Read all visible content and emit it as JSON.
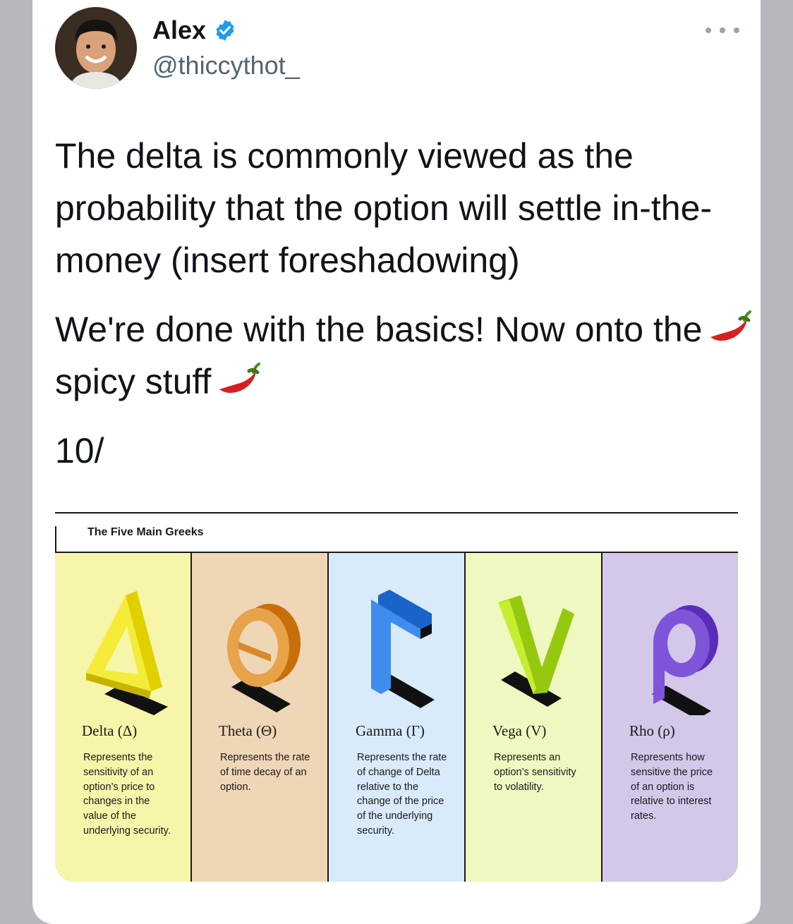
{
  "tweet": {
    "author_name": "Alex",
    "author_handle": "@thiccythot_",
    "paragraph1": "The delta is commonly viewed as the probability that the option will settle in-the-money (insert foreshadowing)",
    "paragraph2_a": "We're done with the basics! Now onto the",
    "paragraph2_b": "spicy stuff",
    "paragraph3": "10/"
  },
  "media": {
    "title": "The Five Main Greeks",
    "greeks": [
      {
        "name": "Delta (Δ)",
        "description": "Represents the sensitivity of an option’s price to changes in the value of the underlying security."
      },
      {
        "name": "Theta (Θ)",
        "description": "Represents the rate of time decay of an option."
      },
      {
        "name": "Gamma (Γ)",
        "description": "Represents the rate of change of Delta relative to the change of the price of the underlying security."
      },
      {
        "name": "Vega (V)",
        "description": "Represents an option’s sensitivity to volatility."
      },
      {
        "name": "Rho (ρ)",
        "description": "Represents how sensitive the price of an option is relative to interest rates."
      }
    ]
  },
  "colors": {
    "verified": "#1d9bf0",
    "delta_bg": "#f7f5a9",
    "theta_bg": "#efd6b6",
    "gamma_bg": "#d9eafb",
    "vega_bg": "#eef8c0",
    "rho_bg": "#d3c7ea"
  }
}
